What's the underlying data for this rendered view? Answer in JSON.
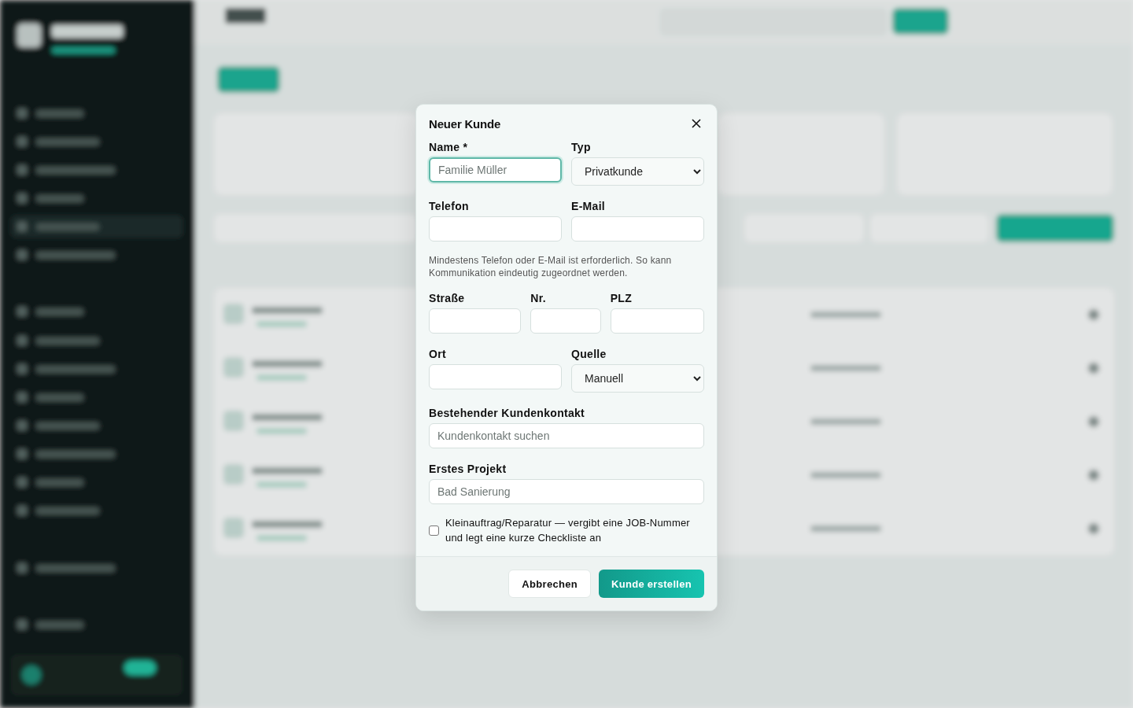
{
  "dialog": {
    "title": "Neuer Kunde",
    "rows": [
      {
        "kind": "fields",
        "fields": [
          {
            "label": "Name *",
            "kind": "text",
            "placeholder": "Familie Müller",
            "focused": true
          },
          {
            "label": "Typ",
            "kind": "select",
            "value": "Privatkunde"
          }
        ]
      },
      {
        "kind": "fields",
        "fields": [
          {
            "label": "Telefon",
            "kind": "text",
            "focused": false
          },
          {
            "label": "E-Mail",
            "kind": "text",
            "focused": false
          }
        ]
      },
      {
        "kind": "hint",
        "text": "Mindestens Telefon oder E-Mail ist erforderlich. So kann Kommunikation eindeutig zugeordnet werden."
      },
      {
        "kind": "fields",
        "fields": [
          {
            "label": "Straße",
            "kind": "text",
            "focused": false
          },
          {
            "label": "Nr.",
            "kind": "text",
            "focused": false
          },
          {
            "label": "PLZ",
            "kind": "text",
            "focused": false
          }
        ]
      },
      {
        "kind": "fields",
        "fields": [
          {
            "label": "Ort",
            "kind": "text",
            "focused": false
          },
          {
            "label": "Quelle",
            "kind": "select",
            "value": "Manuell"
          }
        ]
      },
      {
        "kind": "fields",
        "fields": [
          {
            "label": "Bestehender Kundenkontakt",
            "kind": "text",
            "placeholder": "Kundenkontakt suchen",
            "focused": false
          }
        ]
      },
      {
        "kind": "fields",
        "fields": [
          {
            "label": "Erstes Projekt",
            "kind": "text",
            "placeholder": "Bad Sanierung",
            "focused": false
          }
        ]
      }
    ],
    "checkbox": {
      "label": "Kleinauftrag/Reparatur — vergibt eine JOB-Nummer und legt eine kurze Checkliste an",
      "checked": false
    },
    "buttons": [
      {
        "label": "Abbrechen",
        "kind": "secondary"
      },
      {
        "label": "Kunde erstellen",
        "kind": "primary"
      }
    ]
  }
}
